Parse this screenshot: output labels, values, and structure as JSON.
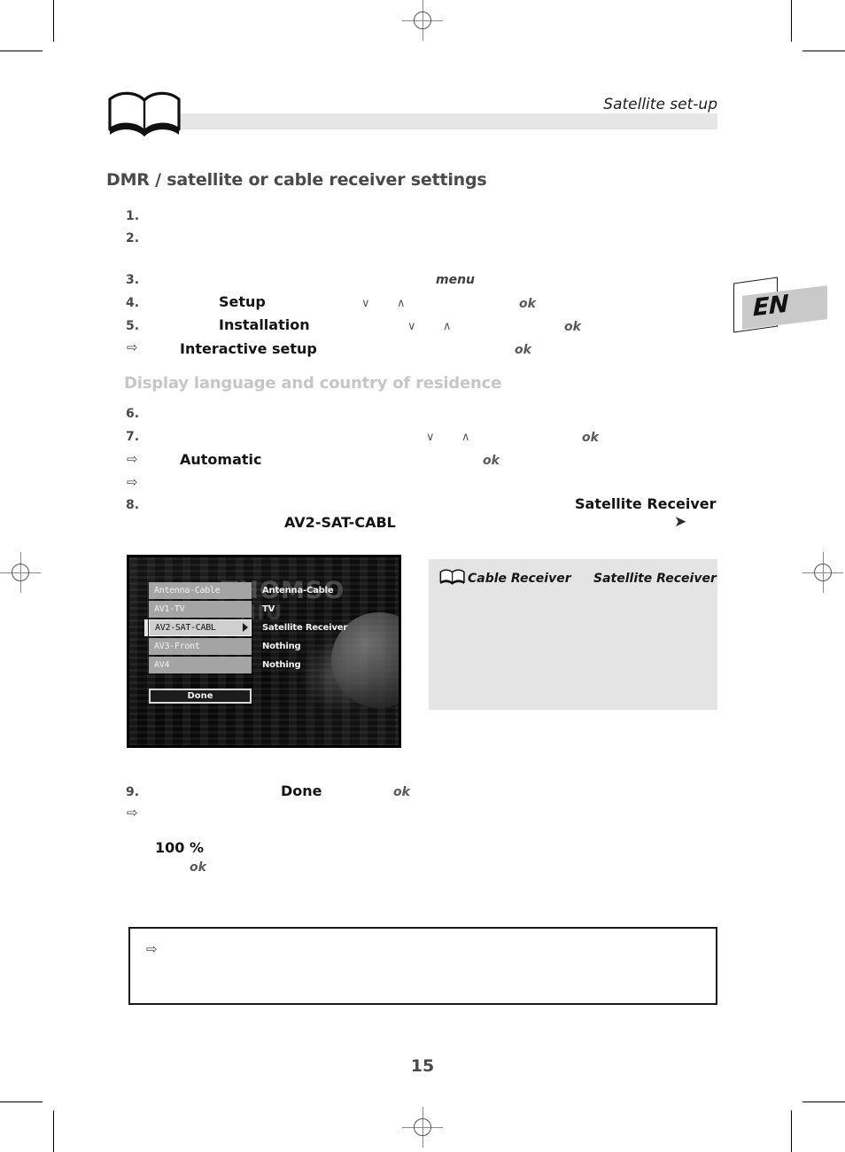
{
  "header": {
    "title": "Satellite set-up",
    "book_icon": "open-book-icon"
  },
  "language_tab": {
    "label": "EN"
  },
  "headings": {
    "main": "DMR / satellite or cable receiver settings",
    "sub": "Display language and country of residence"
  },
  "steps": [
    {
      "marker": "1.",
      "keywords": []
    },
    {
      "marker": "2.",
      "keywords": []
    },
    {
      "marker": "3.",
      "keywords": [
        "menu"
      ]
    },
    {
      "marker": "4.",
      "keywords": [
        "Setup",
        "ok"
      ]
    },
    {
      "marker": "5.",
      "keywords": [
        "Installation",
        "ok"
      ]
    },
    {
      "marker": "⇨",
      "keywords": [
        "Interactive setup",
        "ok"
      ]
    },
    {
      "marker": "6.",
      "keywords": []
    },
    {
      "marker": "7.",
      "keywords": [
        "ok"
      ]
    },
    {
      "marker": "⇨",
      "keywords": [
        "Automatic",
        "ok"
      ]
    },
    {
      "marker": "⇨",
      "keywords": []
    },
    {
      "marker": "8.",
      "keywords": [
        "Satellite Receiver",
        "AV2-SAT-CABL"
      ]
    },
    {
      "marker": "9.",
      "keywords": [
        "Done",
        "ok"
      ]
    },
    {
      "marker": "⇨",
      "keywords": []
    }
  ],
  "step_markers": {
    "s1": "1.",
    "s2": "2.",
    "s3": "3.",
    "s4": "4.",
    "s5": "5.",
    "s6": "6.",
    "s7": "7.",
    "s8": "8.",
    "s9": "9.",
    "arrow": "⇨"
  },
  "keywords": {
    "menu": "menu",
    "setup": "Setup",
    "installation": "Installation",
    "interactive_setup": "Interactive setup",
    "automatic": "Automatic",
    "satellite_receiver": "Satellite Receiver",
    "av2_sat_cabl": "AV2-SAT-CABL",
    "done": "Done",
    "percent_100": "100 %",
    "ok": "ok",
    "chev_down": "∨",
    "chev_up": "∧",
    "chev_right": "➤"
  },
  "tv_screen": {
    "watermark": "THOMSO",
    "watermark2": "NIU",
    "rows": [
      {
        "source": "Antenna-Cable",
        "assignment": "Antenna-Cable",
        "selected": false
      },
      {
        "source": "AV1-TV",
        "assignment": "TV",
        "selected": false
      },
      {
        "source": "AV2-SAT-CABL",
        "assignment": "Satellite Receiver",
        "selected": true
      },
      {
        "source": "AV3-Front",
        "assignment": "Nothing",
        "selected": false
      },
      {
        "source": "AV4",
        "assignment": "Nothing",
        "selected": false
      }
    ],
    "done_button": "Done"
  },
  "note": {
    "icon": "open-book-icon",
    "text_1": "Cable Receiver",
    "text_2": "Satellite Receiver"
  },
  "footer": {
    "page_number": "15"
  },
  "colors": {
    "heading_dark": "#4a4a4a",
    "heading_light": "#c6c6c6",
    "note_bg": "#e4e4e4",
    "header_rule": "#e6e6e6",
    "lang_plate": "#c9c9c9"
  }
}
